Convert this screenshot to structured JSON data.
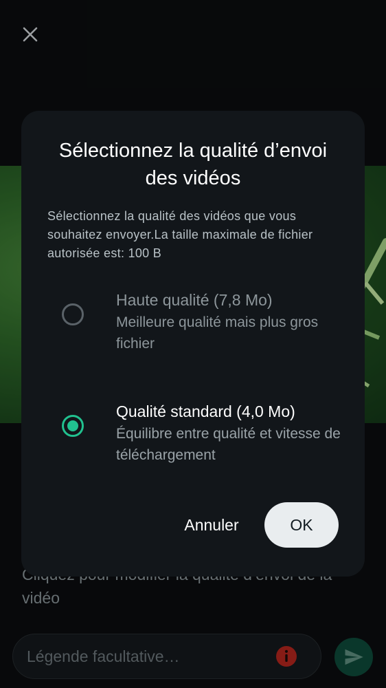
{
  "dialog": {
    "title": "Sélectionnez la qualité d’envoi des vidéos",
    "description": "Sélectionnez la qualité des vidéos que vous souhaitez envoyer.La taille maximale de fichier autorisée est: 100 B",
    "options": [
      {
        "title": "Haute qualité (7,8 Mo)",
        "subtitle": "Meilleure qualité mais plus gros fichier",
        "selected": false
      },
      {
        "title": "Qualité standard (4,0 Mo)",
        "subtitle": "Équilibre entre qualité et vitesse de téléchargement",
        "selected": true
      }
    ],
    "cancel_label": "Annuler",
    "ok_label": "OK"
  },
  "background": {
    "hint": "Cliquez pour modifier la qualité d’envoi de la vidéo",
    "caption_placeholder": "Légende facultative…"
  },
  "icons": {
    "close": "close-icon",
    "info": "info-icon",
    "send": "send-icon"
  },
  "colors": {
    "accent": "#21c18f",
    "dialog_bg": "#12161a",
    "info_red": "#b3261e",
    "send_bg": "#0e4a3a"
  }
}
